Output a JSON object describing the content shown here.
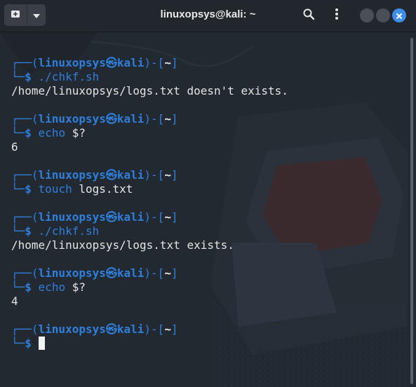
{
  "window": {
    "title": "linuxopsys@kali: ~"
  },
  "colors": {
    "prompt_blue": "#2f7fdc",
    "text": "#e4e4e4",
    "close_button": "#3c8ee8",
    "background": "#232931"
  },
  "icons": {
    "new_tab": "new-tab-icon",
    "menu_arrow": "chevron-down-icon",
    "search": "search-icon",
    "menu": "kebab-menu-icon",
    "minimize": "minimize-icon",
    "maximize": "maximize-icon",
    "close": "close-icon"
  },
  "prompt": {
    "open": "┌──(",
    "user": "linuxopsys",
    "symbol": "㉿",
    "host": "kali",
    "mid": ")-[",
    "dir": "~",
    "close": "]",
    "corner": "└─",
    "dollar": "$"
  },
  "terminal": {
    "blocks": [
      {
        "command": "./chkf.sh",
        "arg": "",
        "output": "/home/linuxopsys/logs.txt doesn't exists."
      },
      {
        "command": "echo",
        "arg": "$?",
        "output": "6"
      },
      {
        "command": "touch",
        "arg": "logs.txt",
        "output": ""
      },
      {
        "command": "./chkf.sh",
        "arg": "",
        "output": "/home/linuxopsys/logs.txt exists."
      },
      {
        "command": "echo",
        "arg": "$?",
        "output": "4"
      },
      {
        "command": "",
        "arg": "",
        "output": ""
      }
    ]
  }
}
